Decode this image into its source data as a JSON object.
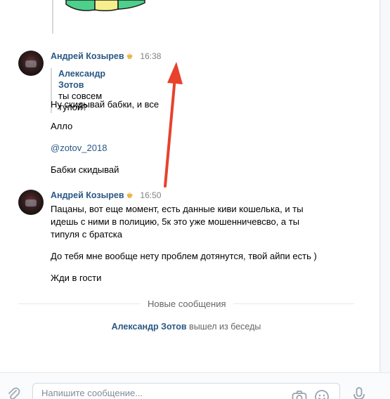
{
  "messages": [
    {
      "author": "Андрей Козырев",
      "time": "16:38",
      "forwarded": {
        "author": "Александр Зотов",
        "text": "ты совсем тупой?"
      },
      "lines": [
        "Ну скидывай бабки, и все",
        "Алло",
        "@zotov_2018",
        "Бабки скидывай"
      ]
    },
    {
      "author": "Андрей Козырев",
      "time": "16:50",
      "lines": [
        "Пацаны, вот еще момент, есть данные киви кошелька, и ты",
        "идешь с ними в полицию, 5к это уже мошенничевсво, а ты",
        "типуля с братска",
        "До тебя мне вообще нету проблем дотянутся, твой айпи есть )",
        "Жди в гости"
      ]
    }
  ],
  "divider": "Новые сообщения",
  "service": {
    "user": "Александр Зотов",
    "action": "вышел из беседы"
  },
  "composer": {
    "placeholder": "Напишите сообщение..."
  },
  "colors": {
    "link": "#2a5885",
    "arrow": "#e8412c",
    "crown": "#e5a823"
  },
  "icons": [
    "crown-icon",
    "paperclip-icon",
    "camera-icon",
    "smile-icon",
    "microphone-icon"
  ]
}
